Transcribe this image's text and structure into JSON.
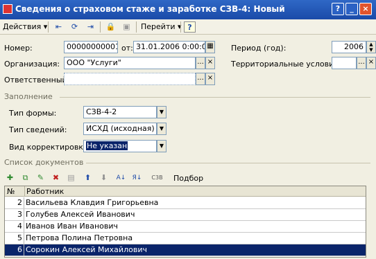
{
  "window": {
    "title": "Сведения о страховом стаже и заработке СЗВ-4: Новый",
    "buttons": {
      "help": "?",
      "minimize": "_",
      "maximize": "□",
      "close": "×"
    }
  },
  "toolbar": {
    "actions_label": "Действия",
    "goto_label": "Перейти",
    "help_label": "?",
    "icons": [
      "back-icon",
      "refresh-icon",
      "forward-icon",
      "lock-icon",
      "save-icon"
    ]
  },
  "form": {
    "number_label": "Номер:",
    "number_value": "00000000001",
    "from_label": "от:",
    "date_value": "31.01.2006  0:00:00",
    "period_label": "Период (год):",
    "period_value": "2006",
    "org_label": "Организация:",
    "org_value": "ООО \"Услуги\"",
    "territory_label": "Территориальные условия:",
    "territory_value": "",
    "responsible_label": "Ответственный:",
    "responsible_value": ""
  },
  "fill_section": {
    "title": "Заполнение",
    "form_type_label": "Тип формы:",
    "form_type_value": "СЗВ-4-2",
    "info_type_label": "Тип сведений:",
    "info_type_value": "ИСХД (исходная)",
    "correction_label": "Вид корректировки:",
    "correction_value": "Не указан"
  },
  "docs_section": {
    "title": "Список документов",
    "select_label": "Подбор",
    "columns": [
      "№",
      "Работник"
    ],
    "rows": [
      {
        "num": "2",
        "name": "Васильева Клавдия Григорьевна"
      },
      {
        "num": "3",
        "name": "Голубев Алексей Иванович"
      },
      {
        "num": "4",
        "name": "Иванов Иван Иванович"
      },
      {
        "num": "5",
        "name": "Петрова Полина Петровна"
      },
      {
        "num": "6",
        "name": "Сорокин Алексей Михайлович"
      }
    ],
    "selected_row": 4
  },
  "colors": {
    "titlebar": "#1f55b8",
    "selection": "#0a246a",
    "background": "#f1efe2"
  }
}
